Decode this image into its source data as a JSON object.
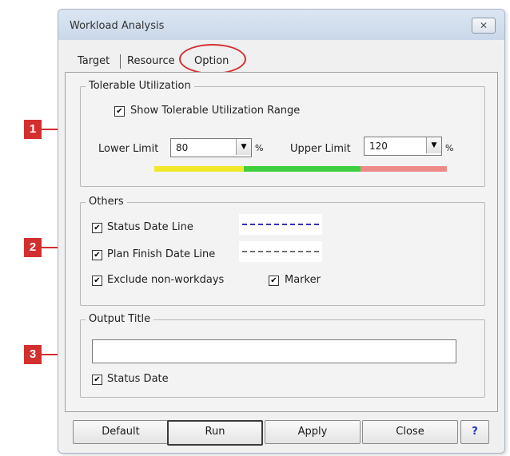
{
  "window": {
    "title": "Workload Analysis",
    "close_glyph": "✕"
  },
  "tabs": [
    {
      "label": "Target"
    },
    {
      "label": "Resource"
    },
    {
      "label": "Option"
    }
  ],
  "tolerable": {
    "group_label": "Tolerable Utilization",
    "show_range_label": "Show Tolerable Utilization Range",
    "show_range_checked": true,
    "lower_label": "Lower Limit",
    "lower_value": "80",
    "lower_unit": "%",
    "upper_label": "Upper Limit",
    "upper_value": "120",
    "upper_unit": "%",
    "colors": {
      "low": "#f2e82a",
      "mid": "#3fcf3f",
      "high": "#ee8a8a"
    }
  },
  "others": {
    "group_label": "Others",
    "status_date_line_label": "Status Date Line",
    "status_date_line_checked": true,
    "status_date_line_color": "#3030c0",
    "plan_finish_label": "Plan Finish Date Line",
    "plan_finish_checked": true,
    "plan_finish_color": "#707070",
    "exclude_label": "Exclude non-workdays",
    "exclude_checked": true,
    "marker_label": "Marker",
    "marker_checked": true
  },
  "output": {
    "group_label": "Output Title",
    "title_value": "",
    "status_date_label": "Status Date",
    "status_date_checked": true
  },
  "buttons": {
    "default": "Default",
    "run": "Run",
    "apply": "Apply",
    "close": "Close",
    "help": "?"
  },
  "callouts": [
    "1",
    "2",
    "3"
  ],
  "check_glyph": "✔",
  "dropdown_glyph": "▼",
  "accent_color": "#d32f2f"
}
